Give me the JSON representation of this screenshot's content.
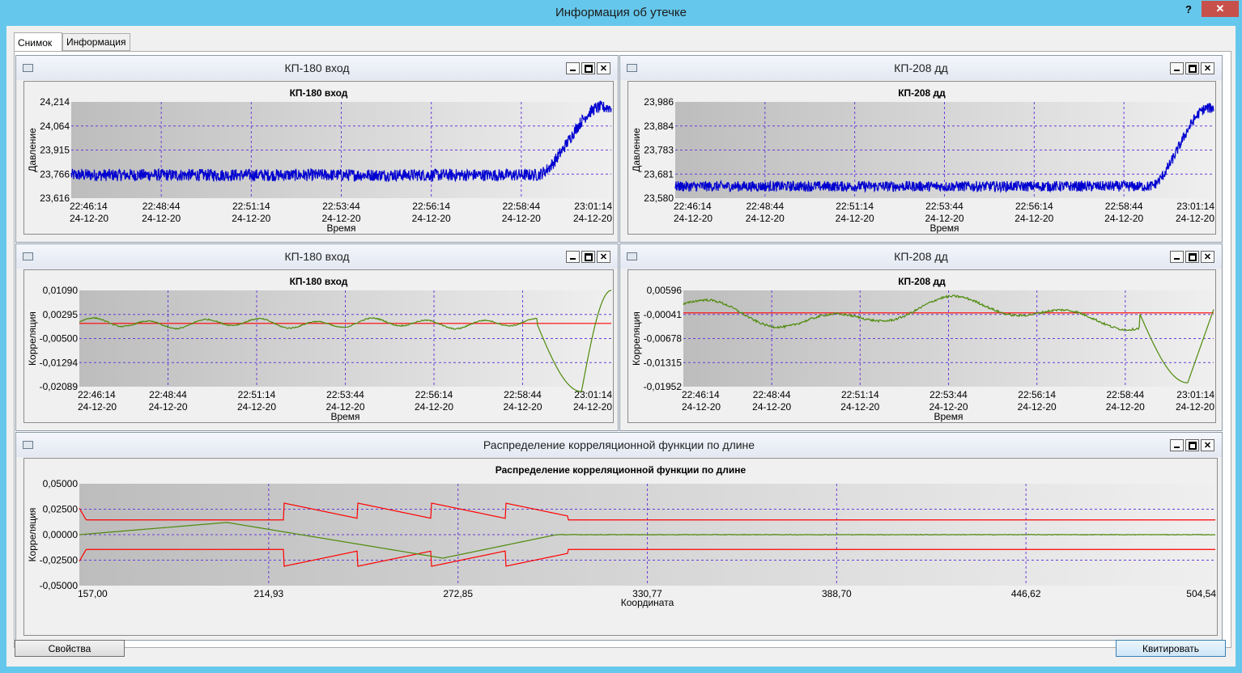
{
  "window": {
    "title": "Информация об утечке",
    "help": "?",
    "close": "✕"
  },
  "tabs": [
    {
      "label": "Снимок",
      "active": true
    },
    {
      "label": "Информация",
      "active": false
    }
  ],
  "buttons": {
    "properties": "Свойства",
    "acknowledge": "Квитировать"
  },
  "panel_buttons": {
    "close": "✕"
  },
  "panels": [
    {
      "header": "КП-180 вход",
      "chart_data": {
        "type": "line",
        "title": "КП-180 вход",
        "ylabel": "Давление",
        "xlabel": "Время",
        "yticks": [
          "24,214",
          "24,064",
          "23,915",
          "23,766",
          "23,616"
        ],
        "ylim": [
          23.616,
          24.214
        ],
        "xticks": [
          [
            "22:46:14",
            "24-12-20"
          ],
          [
            "22:48:44",
            "24-12-20"
          ],
          [
            "22:51:14",
            "24-12-20"
          ],
          [
            "22:53:44",
            "24-12-20"
          ],
          [
            "22:56:14",
            "24-12-20"
          ],
          [
            "22:58:44",
            "24-12-20"
          ],
          [
            "23:01:14",
            "24-12-20"
          ]
        ],
        "series": [
          {
            "color": "#0000d0",
            "base": 23.76,
            "noise": 0.038,
            "rise_start": 0.86,
            "rise_end": 0.98,
            "end": 24.18
          }
        ],
        "ref_line": null
      }
    },
    {
      "header": "КП-208 дд",
      "chart_data": {
        "type": "line",
        "title": "КП-208 дд",
        "ylabel": "Давление",
        "xlabel": "Время",
        "yticks": [
          "23,986",
          "23,884",
          "23,783",
          "23,681",
          "23,580"
        ],
        "ylim": [
          23.58,
          23.986
        ],
        "xticks": [
          [
            "22:46:14",
            "24-12-20"
          ],
          [
            "22:48:44",
            "24-12-20"
          ],
          [
            "22:51:14",
            "24-12-20"
          ],
          [
            "22:53:44",
            "24-12-20"
          ],
          [
            "22:56:14",
            "24-12-20"
          ],
          [
            "22:58:44",
            "24-12-20"
          ],
          [
            "23:01:14",
            "24-12-20"
          ]
        ],
        "series": [
          {
            "color": "#0000d0",
            "base": 23.63,
            "noise": 0.022,
            "rise_start": 0.88,
            "rise_end": 0.99,
            "end": 23.96
          }
        ],
        "ref_line": null
      }
    },
    {
      "header": "КП-180 вход",
      "chart_data": {
        "type": "line",
        "title": "КП-180 вход",
        "ylabel": "Корреляция",
        "xlabel": "Время",
        "yticks": [
          "0,01090",
          "0,00295",
          "-0,00500",
          "-0,01294",
          "-0,02089"
        ],
        "ylim": [
          -0.02089,
          0.0109
        ],
        "xticks": [
          [
            "22:46:14",
            "24-12-20"
          ],
          [
            "22:48:44",
            "24-12-20"
          ],
          [
            "22:51:14",
            "24-12-20"
          ],
          [
            "22:53:44",
            "24-12-20"
          ],
          [
            "22:56:14",
            "24-12-20"
          ],
          [
            "22:58:44",
            "24-12-20"
          ],
          [
            "23:01:14",
            "24-12-20"
          ]
        ],
        "series": [
          {
            "color": "#4e8a0a",
            "kind": "corr180"
          }
        ],
        "ref_line": {
          "value": 0.0,
          "color": "#ff0000"
        }
      }
    },
    {
      "header": "КП-208 дд",
      "chart_data": {
        "type": "line",
        "title": "КП-208 дд",
        "ylabel": "Корреляция",
        "xlabel": "Время",
        "yticks": [
          "0,00596",
          "-0,00041",
          "-0,00678",
          "-0,01315",
          "-0,01952"
        ],
        "ylim": [
          -0.01952,
          0.00596
        ],
        "xticks": [
          [
            "22:46:14",
            "24-12-20"
          ],
          [
            "22:48:44",
            "24-12-20"
          ],
          [
            "22:51:14",
            "24-12-20"
          ],
          [
            "22:53:44",
            "24-12-20"
          ],
          [
            "22:56:14",
            "24-12-20"
          ],
          [
            "22:58:44",
            "24-12-20"
          ],
          [
            "23:01:14",
            "24-12-20"
          ]
        ],
        "series": [
          {
            "color": "#4e8a0a",
            "kind": "corr208"
          }
        ],
        "ref_line": {
          "value": 0.0,
          "color": "#ff0000"
        }
      }
    },
    {
      "header": "Распределение корреляционной функции по длине",
      "chart_data": {
        "type": "line",
        "title": "Распределение корреляционной функции по длине",
        "ylabel": "Корреляция",
        "xlabel": "Координата",
        "yticks": [
          "0,05000",
          "0,02500",
          "0,00000",
          "-0,02500",
          "-0,05000"
        ],
        "ylim": [
          -0.05,
          0.05
        ],
        "xticks": [
          [
            "157,00"
          ],
          [
            "214,93"
          ],
          [
            "272,85"
          ],
          [
            "330,77"
          ],
          [
            "388,70"
          ],
          [
            "446,62"
          ],
          [
            "504,54"
          ]
        ],
        "series": [
          {
            "color": "#4e8a0a",
            "kind": "dist"
          }
        ],
        "ref_line": null
      }
    }
  ]
}
